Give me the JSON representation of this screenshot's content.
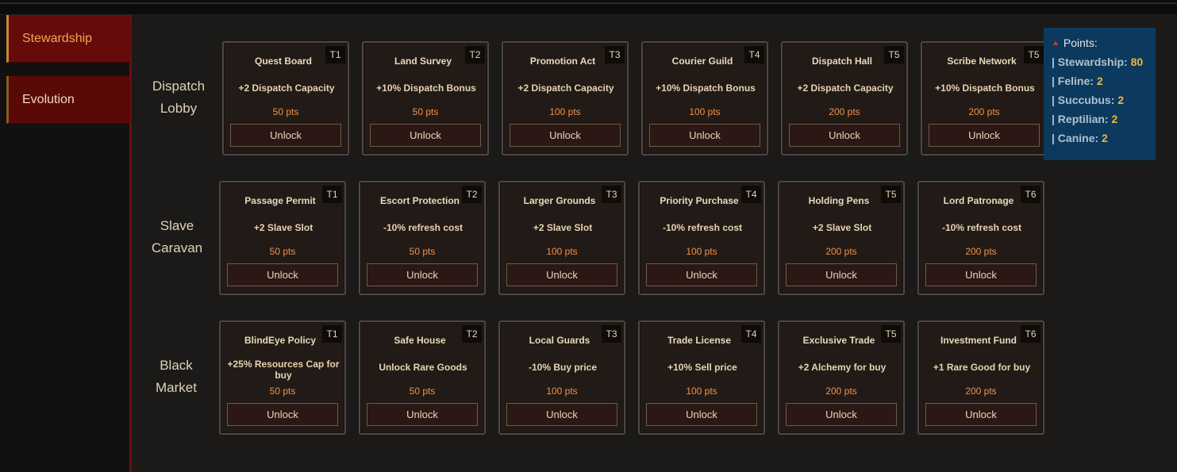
{
  "sidebar": {
    "tabs": [
      {
        "label": "Stewardship",
        "active": true
      },
      {
        "label": "Evolution",
        "active": false
      }
    ]
  },
  "rows": [
    {
      "label": "Dispatch Lobby",
      "cards": [
        {
          "name": "Quest Board",
          "tier": "T1",
          "effect": "+2 Dispatch Capacity",
          "cost": "50 pts",
          "button": "Unlock"
        },
        {
          "name": "Land Survey",
          "tier": "T2",
          "effect": "+10% Dispatch Bonus",
          "cost": "50 pts",
          "button": "Unlock"
        },
        {
          "name": "Promotion Act",
          "tier": "T3",
          "effect": "+2 Dispatch Capacity",
          "cost": "100 pts",
          "button": "Unlock"
        },
        {
          "name": "Courier Guild",
          "tier": "T4",
          "effect": "+10% Dispatch Bonus",
          "cost": "100 pts",
          "button": "Unlock"
        },
        {
          "name": "Dispatch Hall",
          "tier": "T5",
          "effect": "+2 Dispatch Capacity",
          "cost": "200 pts",
          "button": "Unlock"
        },
        {
          "name": "Scribe Network",
          "tier": "T5",
          "effect": "+10% Dispatch Bonus",
          "cost": "200 pts",
          "button": "Unlock"
        }
      ]
    },
    {
      "label": "Slave Caravan",
      "cards": [
        {
          "name": "Passage Permit",
          "tier": "T1",
          "effect": "+2 Slave Slot",
          "cost": "50 pts",
          "button": "Unlock"
        },
        {
          "name": "Escort Protection",
          "tier": "T2",
          "effect": "-10% refresh cost",
          "cost": "50 pts",
          "button": "Unlock"
        },
        {
          "name": "Larger Grounds",
          "tier": "T3",
          "effect": "+2 Slave Slot",
          "cost": "100 pts",
          "button": "Unlock"
        },
        {
          "name": "Priority Purchase",
          "tier": "T4",
          "effect": "-10% refresh cost",
          "cost": "100 pts",
          "button": "Unlock"
        },
        {
          "name": "Holding Pens",
          "tier": "T5",
          "effect": "+2 Slave Slot",
          "cost": "200 pts",
          "button": "Unlock"
        },
        {
          "name": "Lord Patronage",
          "tier": "T6",
          "effect": "-10% refresh cost",
          "cost": "200 pts",
          "button": "Unlock"
        }
      ]
    },
    {
      "label": "Black Market",
      "cards": [
        {
          "name": "BlindEye Policy",
          "tier": "T1",
          "effect": "+25% Resources Cap for buy",
          "cost": "50 pts",
          "button": "Unlock"
        },
        {
          "name": "Safe House",
          "tier": "T2",
          "effect": "Unlock Rare Goods",
          "cost": "50 pts",
          "button": "Unlock"
        },
        {
          "name": "Local Guards",
          "tier": "T3",
          "effect": "-10% Buy price",
          "cost": "100 pts",
          "button": "Unlock"
        },
        {
          "name": "Trade License",
          "tier": "T4",
          "effect": "+10% Sell price",
          "cost": "100 pts",
          "button": "Unlock"
        },
        {
          "name": "Exclusive Trade",
          "tier": "T5",
          "effect": "+2 Alchemy for buy",
          "cost": "200 pts",
          "button": "Unlock"
        },
        {
          "name": "Investment Fund",
          "tier": "T6",
          "effect": "+1 Rare Good for buy",
          "cost": "200 pts",
          "button": "Unlock"
        }
      ]
    }
  ],
  "points": {
    "title": "Points:",
    "icon": "triangle-up-icon",
    "entries": [
      {
        "label": "| Stewardship:",
        "value": "80"
      },
      {
        "label": "| Feline:",
        "value": "2"
      },
      {
        "label": "| Succubus:",
        "value": "2"
      },
      {
        "label": "| Reptilian:",
        "value": "2"
      },
      {
        "label": "| Canine:",
        "value": "2"
      }
    ]
  },
  "colors": {
    "accent": "#f0a94c",
    "tab_bg": "#5a0909",
    "cost": "#f0924c",
    "points_bg": "#0b3a5e",
    "points_value": "#f2b53a"
  }
}
